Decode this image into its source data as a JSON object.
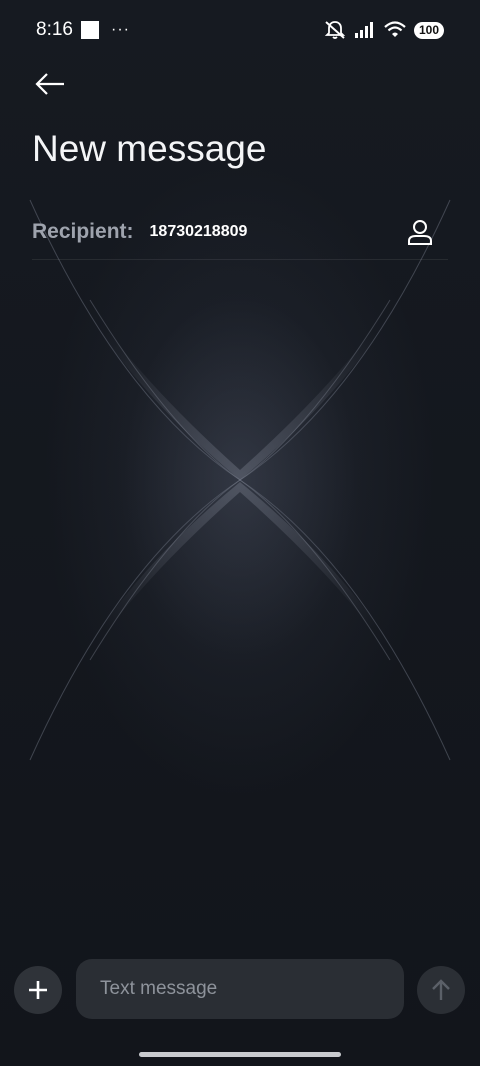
{
  "status_bar": {
    "time": "8:16",
    "dots": "···",
    "battery": "100",
    "icons": [
      "notification-square-icon",
      "bell-muted-icon",
      "signal-icon",
      "wifi-icon",
      "battery-icon"
    ]
  },
  "header": {
    "back_icon": "arrow-left-icon",
    "title": "New message"
  },
  "recipient": {
    "label": "Recipient:",
    "value": "18730218809",
    "contact_icon": "person-icon"
  },
  "compose": {
    "add_icon": "plus-icon",
    "placeholder": "Text message",
    "send_icon": "arrow-up-icon"
  },
  "colors": {
    "background": "#14171d",
    "field": "#2a2e34",
    "label_gray": "#9ea3ad"
  }
}
